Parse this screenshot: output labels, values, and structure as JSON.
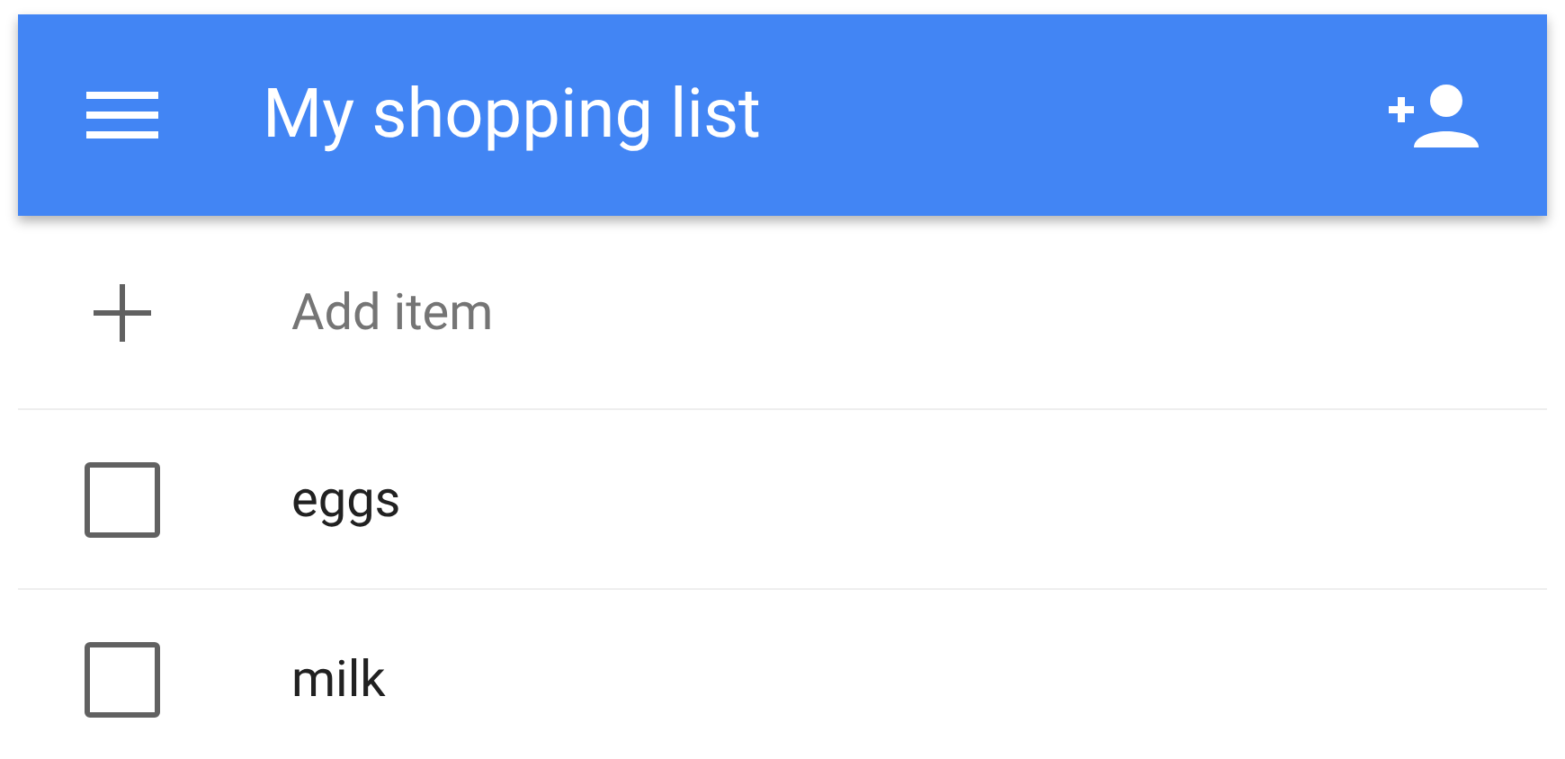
{
  "app_bar": {
    "title": "My shopping list"
  },
  "add_item": {
    "placeholder": "Add item"
  },
  "items": [
    {
      "label": "eggs",
      "checked": false
    },
    {
      "label": "milk",
      "checked": false
    }
  ]
}
